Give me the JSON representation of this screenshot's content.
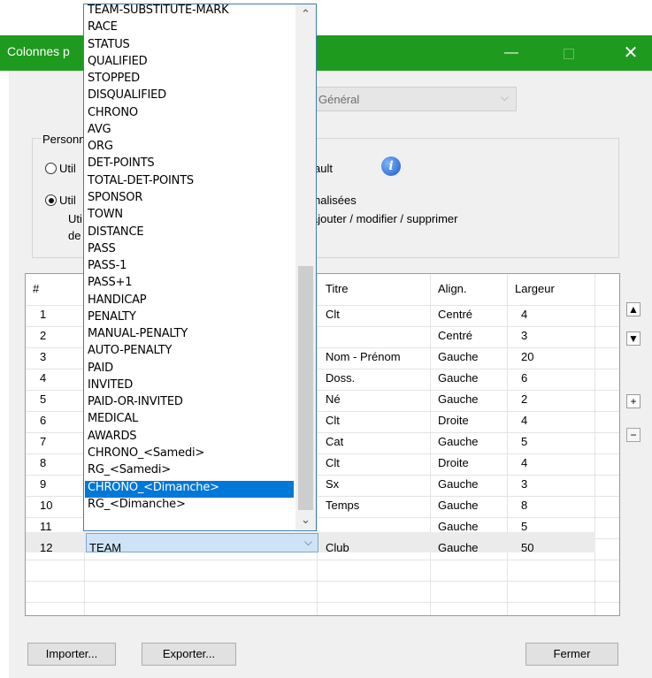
{
  "window": {
    "title": "Colonnes p",
    "minimize_glyph": "—",
    "close_glyph": "✕",
    "titlebar_color": "#1e9a1e"
  },
  "top_combo": {
    "value": "Général",
    "arrow": "⌵"
  },
  "group": {
    "legend": "Personn",
    "option1": {
      "label_left": "Util",
      "label_right": "ault",
      "selected": false
    },
    "option2": {
      "label_left": "Util",
      "label_right": "nalisées",
      "sub_left1": "Uti",
      "sub_right": "ajouter / modifier / supprimer",
      "sub_left2": "de",
      "selected": true
    },
    "info_icon": "i"
  },
  "grid": {
    "headers": {
      "num": "#",
      "titre": "Titre",
      "align": "Align.",
      "largeur": "Largeur"
    },
    "rows": [
      {
        "num": "1",
        "field": "",
        "titre": "Clt",
        "align": "Centré",
        "largeur": "4"
      },
      {
        "num": "2",
        "field": "",
        "titre": "",
        "align": "Centré",
        "largeur": "3"
      },
      {
        "num": "3",
        "field": "",
        "titre": "Nom - Prénom",
        "align": "Gauche",
        "largeur": "20"
      },
      {
        "num": "4",
        "field": "",
        "titre": "Doss.",
        "align": "Gauche",
        "largeur": "6"
      },
      {
        "num": "5",
        "field": "",
        "titre": "Né",
        "align": "Gauche",
        "largeur": "2"
      },
      {
        "num": "6",
        "field": "",
        "titre": "Clt",
        "align": "Droite",
        "largeur": "4"
      },
      {
        "num": "7",
        "field": "",
        "titre": "Cat",
        "align": "Gauche",
        "largeur": "5"
      },
      {
        "num": "8",
        "field": "",
        "titre": "Clt",
        "align": "Droite",
        "largeur": "4"
      },
      {
        "num": "9",
        "field": "",
        "titre": "Sx",
        "align": "Gauche",
        "largeur": "3"
      },
      {
        "num": "10",
        "field": "",
        "titre": "Temps",
        "align": "Gauche",
        "largeur": "8"
      },
      {
        "num": "11",
        "field": "",
        "titre": "",
        "align": "Gauche",
        "largeur": "5"
      },
      {
        "num": "12",
        "field": "TEAM",
        "titre": "Club",
        "align": "Gauche",
        "largeur": "50"
      }
    ]
  },
  "side_buttons": {
    "up": "▲",
    "down": "▼",
    "add": "+",
    "remove": "−"
  },
  "buttons": {
    "importer": "Importer...",
    "exporter": "Exporter...",
    "fermer": "Fermer"
  },
  "dropdown": {
    "selected_index": 28,
    "scroll_up": "⌃",
    "scroll_down": "⌄",
    "items": [
      "TEAM-SUBSTITUTE-MARK",
      "RACE",
      "STATUS",
      "QUALIFIED",
      "STOPPED",
      "DISQUALIFIED",
      "CHRONO",
      "AVG",
      "ORG",
      "DET-POINTS",
      "TOTAL-DET-POINTS",
      "SPONSOR",
      "TOWN",
      "DISTANCE",
      "PASS",
      "PASS-1",
      "PASS+1",
      "HANDICAP",
      "PENALTY",
      "MANUAL-PENALTY",
      "AUTO-PENALTY",
      "PAID",
      "INVITED",
      "PAID-OR-INVITED",
      "MEDICAL",
      "AWARDS",
      "CHRONO_<Samedi>",
      "RG_<Samedi>",
      "CHRONO_<Dimanche>",
      "RG_<Dimanche>"
    ]
  }
}
